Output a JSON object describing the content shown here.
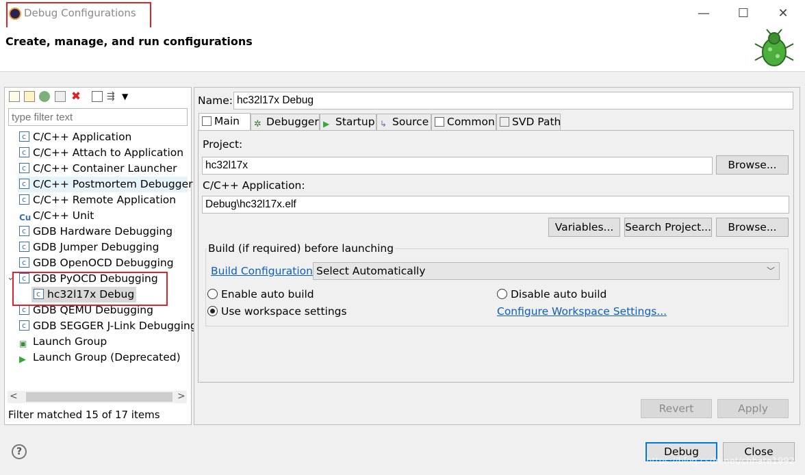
{
  "window": {
    "title": "Debug Configurations",
    "header_title": "Create, manage, and run configurations",
    "minimize_glyph": "—",
    "maximize_glyph": "☐",
    "close_glyph": "✕"
  },
  "left": {
    "filter_placeholder": "type filter text",
    "tree": [
      {
        "label": "C/C++ Application",
        "icon": "c-config-icon"
      },
      {
        "label": "C/C++ Attach to Application",
        "icon": "c-config-icon"
      },
      {
        "label": "C/C++ Container Launcher",
        "icon": "c-config-icon"
      },
      {
        "label": "C/C++ Postmortem Debugger",
        "icon": "c-config-icon"
      },
      {
        "label": "C/C++ Remote Application",
        "icon": "c-config-icon"
      },
      {
        "label": "C/C++ Unit",
        "icon": "cunit-icon"
      },
      {
        "label": "GDB Hardware Debugging",
        "icon": "c-config-icon"
      },
      {
        "label": "GDB Jumper Debugging",
        "icon": "c-config-icon"
      },
      {
        "label": "GDB OpenOCD Debugging",
        "icon": "c-config-icon"
      },
      {
        "label": "GDB PyOCD Debugging",
        "icon": "c-config-icon"
      },
      {
        "label": "hc32l17x Debug",
        "icon": "c-config-icon"
      },
      {
        "label": "GDB QEMU Debugging",
        "icon": "c-config-icon"
      },
      {
        "label": "GDB SEGGER J-Link Debugging",
        "icon": "c-config-icon"
      },
      {
        "label": "Launch Group",
        "icon": "launch-group-icon"
      },
      {
        "label": "Launch Group (Deprecated)",
        "icon": "run-arrow-icon"
      }
    ],
    "status": "Filter matched 15 of 17 items",
    "scroll_left": "<",
    "scroll_right": ">",
    "expand_glyph": "⌄"
  },
  "right": {
    "name_label": "Name:",
    "name_value": "hc32l17x Debug",
    "tabs": [
      "Main",
      "Debugger",
      "Startup",
      "Source",
      "Common",
      "SVD Path"
    ],
    "project_label": "Project:",
    "project_value": "hc32l17x",
    "browse_label": "Browse...",
    "app_label": "C/C++ Application:",
    "app_value": "Debug\\hc32l17x.elf",
    "variables_label": "Variables...",
    "search_project_label": "Search Project...",
    "build_group_label": "Build (if required) before launching",
    "build_config_link": "Build Configuration:",
    "build_config_value": "Select Automatically",
    "enable_auto_build": "Enable auto build",
    "disable_auto_build": "Disable auto build",
    "use_workspace": "Use workspace settings",
    "configure_workspace_link": "Configure Workspace Settings...",
    "revert_label": "Revert",
    "apply_label": "Apply"
  },
  "footer": {
    "help_glyph": "?",
    "debug_label": "Debug",
    "close_label": "Close",
    "watermark": "https://blog.csdn.net/chhate1992"
  },
  "colors": {
    "highlight_box": "#e0222a",
    "link": "#0b5fbd",
    "selection": "#cce8ff"
  }
}
